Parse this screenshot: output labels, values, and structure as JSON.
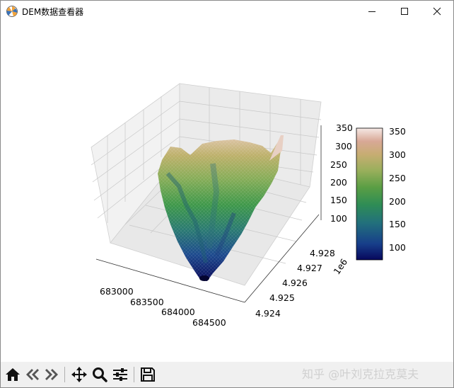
{
  "window": {
    "title": "DEM数据查看器",
    "minimize_icon": "minimize-icon",
    "maximize_icon": "maximize-icon",
    "close_icon": "close-icon"
  },
  "plot": {
    "x_ticks": [
      "683000",
      "683500",
      "684000",
      "684500"
    ],
    "y_ticks": [
      "4.924",
      "4.925",
      "4.926",
      "4.927",
      "4.928"
    ],
    "y_offset": "1e6",
    "z_ticks": [
      "100",
      "150",
      "200",
      "250",
      "300",
      "350"
    ],
    "colorbar_ticks": [
      "100",
      "150",
      "200",
      "250",
      "300",
      "350"
    ],
    "colormap": "gist_earth",
    "colormap_colors": [
      "#0a0a6e",
      "#1f4e9a",
      "#2b8a7a",
      "#3fa04a",
      "#8ab060",
      "#c8b070",
      "#d8a888",
      "#f0dcd8"
    ]
  },
  "toolbar": {
    "home_icon": "home-icon",
    "back_icon": "back-arrow-icon",
    "forward_icon": "forward-arrow-icon",
    "pan_icon": "pan-move-icon",
    "zoom_icon": "zoom-magnifier-icon",
    "configure_icon": "configure-subplots-icon",
    "save_icon": "save-floppy-icon"
  },
  "watermark": "知乎 @叶刘克拉克莫夫"
}
